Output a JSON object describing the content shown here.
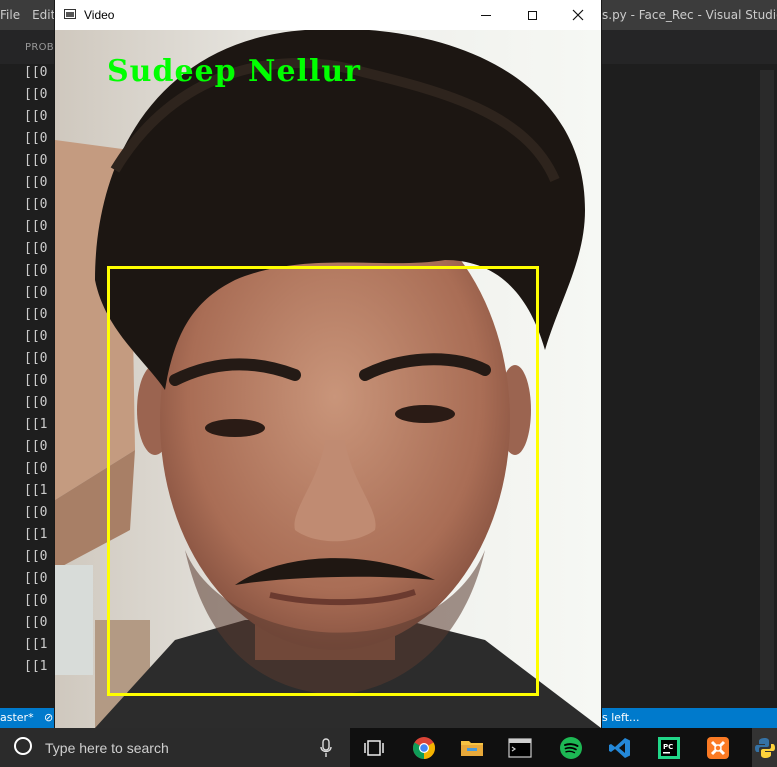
{
  "vscode": {
    "menu": [
      "File",
      "Edit"
    ],
    "title": "s.py - Face_Rec - Visual Studio Co",
    "panel_tab": "PROBL",
    "terminal_lines": [
      "[[0",
      "[[0",
      "[[0",
      "[[0",
      "[[0",
      "[[0",
      "[[0",
      "[[0",
      "[[0",
      "[[0",
      "[[0",
      "[[0",
      "[[0",
      "[[0",
      "[[0",
      "[[0",
      "[[1",
      "[[0",
      "[[0",
      "[[1",
      "[[0",
      "[[1",
      "[[0",
      "[[0",
      "[[0",
      "[[0",
      "[[1",
      "[[1"
    ],
    "status_left": "aster*",
    "status_left2": "⊘",
    "status_right": "s left..."
  },
  "video_window": {
    "title": "Video",
    "detected_name": "Sudeep Nellur",
    "box_color": "#ffff00",
    "label_color": "#00ff00"
  },
  "taskbar": {
    "search_placeholder": "Type here to search",
    "apps": [
      "task-view",
      "chrome",
      "file-explorer",
      "terminal",
      "spotify",
      "vscode",
      "pycharm",
      "xampp",
      "python"
    ]
  }
}
